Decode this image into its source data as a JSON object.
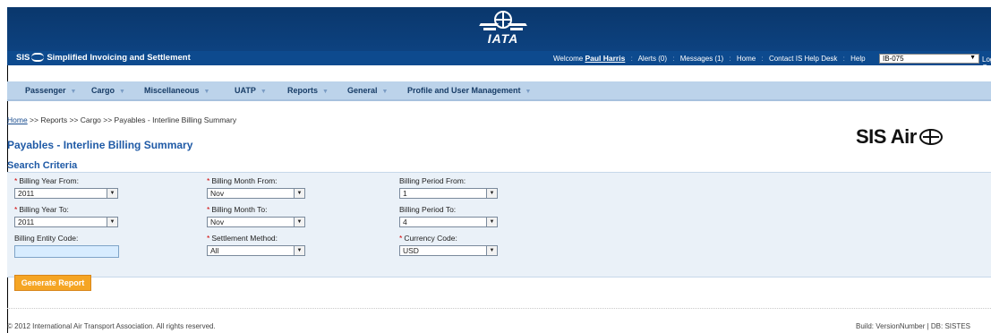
{
  "header": {
    "logo_text": "IATA",
    "brand": "Simplified Invoicing and Settlement",
    "brand_prefix": "SIS",
    "welcome": "Welcome",
    "user_name": "Paul Harris",
    "links": [
      "Alerts (0)",
      "Messages (1)",
      "Home",
      "Contact IS Help Desk",
      "Help"
    ],
    "member_select": "IB-075",
    "logoff": "Log O"
  },
  "menu": [
    {
      "label": "Passenger"
    },
    {
      "label": "Cargo"
    },
    {
      "label": "Miscellaneous"
    },
    {
      "label": "UATP"
    },
    {
      "label": "Reports"
    },
    {
      "label": "General"
    },
    {
      "label": "Profile and User Management"
    }
  ],
  "breadcrumb": {
    "home": "Home",
    "rest": " >> Reports >> Cargo >> Payables - Interline Billing Summary"
  },
  "page": {
    "title": "Payables - Interline Billing Summary",
    "logo": "SIS Air",
    "section": "Search Criteria"
  },
  "form": {
    "billing_year_from": {
      "label": "Billing Year From:",
      "value": "2011"
    },
    "billing_month_from": {
      "label": "Billing Month From:",
      "value": "Nov"
    },
    "billing_period_from": {
      "label": "Billing Period From:",
      "value": "1"
    },
    "billing_year_to": {
      "label": "Billing Year To:",
      "value": "2011"
    },
    "billing_month_to": {
      "label": "Billing Month To:",
      "value": "Nov"
    },
    "billing_period_to": {
      "label": "Billing Period To:",
      "value": "4"
    },
    "billing_entity_code": {
      "label": "Billing Entity Code:",
      "value": ""
    },
    "settlement_method": {
      "label": "Settlement Method:",
      "value": "All"
    },
    "currency_code": {
      "label": "Currency Code:",
      "value": "USD"
    },
    "required_mark": "*",
    "generate_button": "Generate Report"
  },
  "footer": {
    "copyright": "© 2012 International Air Transport Association. All rights reserved.",
    "build": "Build: VersionNumber | DB: SISTES"
  },
  "colors": {
    "header_bg": "#0b3a73",
    "menu_bg": "#bcd3ea",
    "title_blue": "#1f5aa6",
    "button_orange": "#f5a524"
  }
}
